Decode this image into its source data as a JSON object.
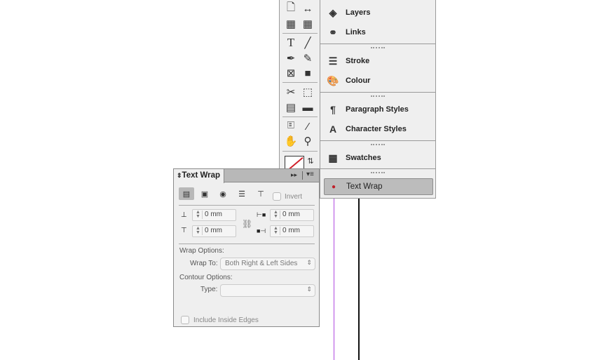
{
  "toolbar": {
    "tools": [
      "page-tool",
      "gap-tool",
      "content-collector-tool",
      "content-placer-tool",
      "type-tool",
      "line-tool",
      "pen-tool",
      "pencil-tool",
      "rectangle-frame-tool",
      "rectangle-tool",
      "scissors-tool",
      "free-transform-tool",
      "gradient-swatch-tool",
      "gradient-feather-tool",
      "note-tool",
      "eyedropper-tool",
      "hand-tool",
      "zoom-tool"
    ]
  },
  "dock": {
    "items": [
      {
        "label": "Layers",
        "icon": "layers-icon"
      },
      {
        "label": "Links",
        "icon": "links-icon"
      },
      {
        "label": "Stroke",
        "icon": "stroke-icon"
      },
      {
        "label": "Colour",
        "icon": "colour-palette-icon"
      },
      {
        "label": "Paragraph Styles",
        "icon": "paragraph-styles-icon"
      },
      {
        "label": "Character Styles",
        "icon": "character-styles-icon"
      },
      {
        "label": "Swatches",
        "icon": "swatches-icon"
      },
      {
        "label": "Text Wrap",
        "icon": "text-wrap-icon",
        "selected": true
      }
    ]
  },
  "panel": {
    "title": "Text Wrap",
    "invert_label": "Invert",
    "top_offset": "0 mm",
    "bottom_offset": "0 mm",
    "left_offset": "0 mm",
    "right_offset": "0 mm",
    "wrap_options_label": "Wrap Options:",
    "wrap_to_label": "Wrap To:",
    "wrap_to_value": "Both Right & Left Sides",
    "contour_options_label": "Contour Options:",
    "type_label": "Type:",
    "type_value": "",
    "include_inside_edges_label": "Include Inside Edges"
  },
  "colors": {
    "guide": "#b04ce0",
    "selected_item": "#bcbcbc"
  }
}
